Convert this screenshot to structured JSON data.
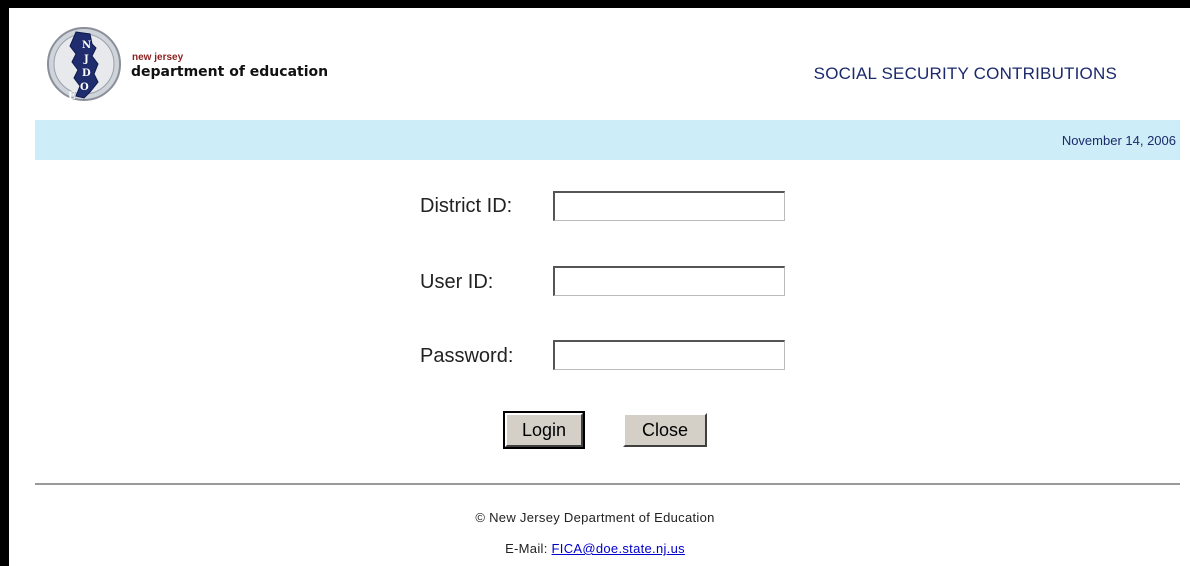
{
  "header": {
    "logo_small_text": "new jersey",
    "logo_large_text": "department of education",
    "app_title": "SOCIAL SECURITY CONTRIBUTIONS"
  },
  "banner": {
    "date": "November 14, 2006",
    "background_color": "#cdeef8"
  },
  "login_form": {
    "district_label": "District ID:",
    "district_value": "",
    "user_label": "User ID:",
    "user_value": "",
    "password_label": "Password:",
    "password_value": "",
    "login_button": "Login",
    "close_button": "Close"
  },
  "footer": {
    "copyright": "© New Jersey Department of Education",
    "email_label": "E-Mail:",
    "email_link": "FICA@doe.state.nj.us"
  },
  "icons": {
    "logo": "nj-doe-emblem-icon"
  }
}
